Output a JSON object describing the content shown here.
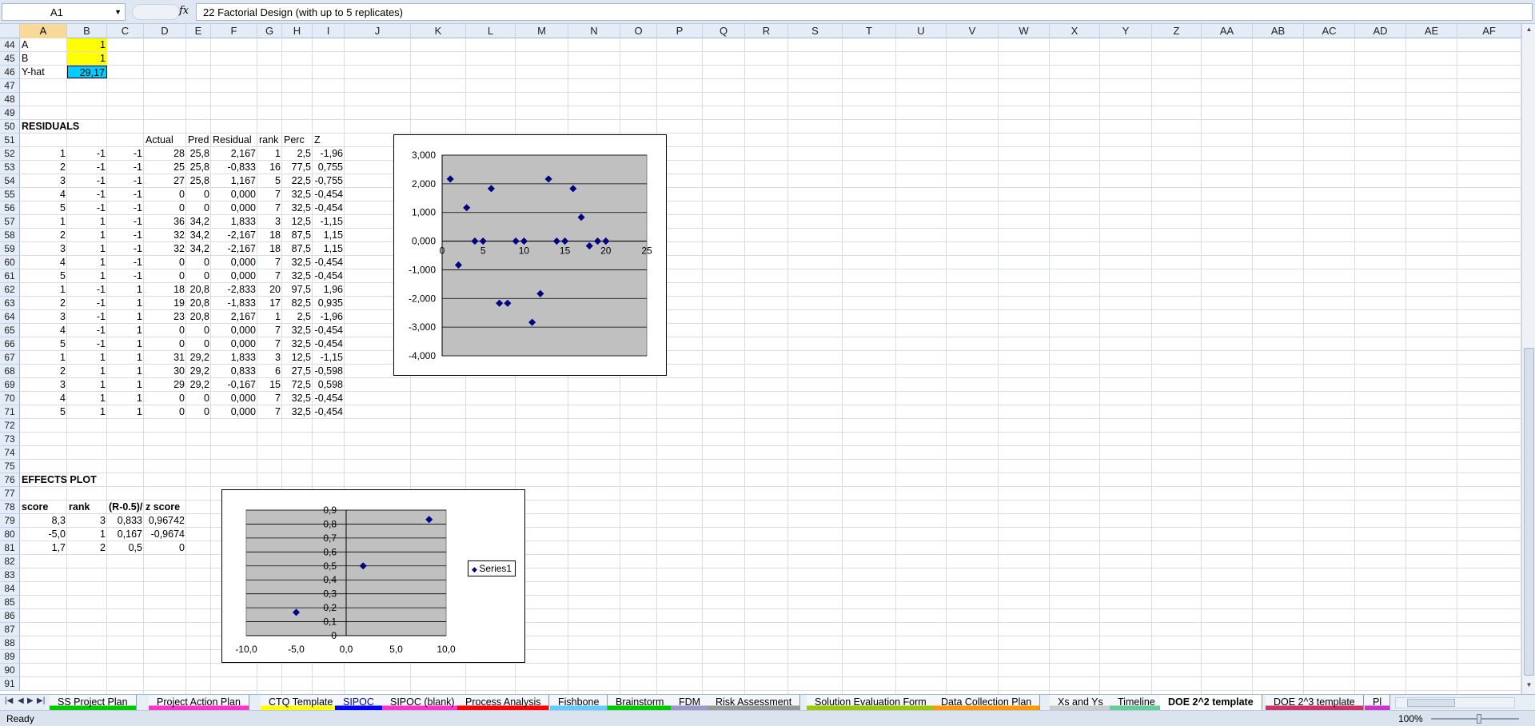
{
  "formula_bar": {
    "name_box": "A1",
    "fx": "fx",
    "formula": "22 Factorial Design (with up to 5 replicates)"
  },
  "columns": [
    "A",
    "B",
    "C",
    "D",
    "E",
    "F",
    "G",
    "H",
    "I",
    "J",
    "K",
    "L",
    "M",
    "N",
    "O",
    "P",
    "Q",
    "R",
    "S",
    "T",
    "U",
    "V",
    "W",
    "X",
    "Y",
    "Z",
    "AA",
    "AB",
    "AC",
    "AD",
    "AE",
    "AF"
  ],
  "rows": [
    "44",
    "45",
    "46",
    "47",
    "48",
    "49",
    "50",
    "51",
    "52",
    "53",
    "54",
    "55",
    "56",
    "57",
    "58",
    "59",
    "60",
    "61",
    "62",
    "63",
    "64",
    "65",
    "66",
    "67",
    "68",
    "69",
    "70",
    "71",
    "72",
    "73",
    "74",
    "75",
    "76",
    "77",
    "78",
    "79",
    "80",
    "81",
    "82",
    "83",
    "84",
    "85",
    "86",
    "87",
    "88",
    "89",
    "90",
    "91"
  ],
  "top_cells": {
    "a_label": "A",
    "a_val": "1",
    "b_label": "B",
    "b_val": "1",
    "yhat_label": "Y-hat",
    "yhat_val": "29,17"
  },
  "residuals": {
    "title": "RESIDUALS",
    "headers": [
      "Actual",
      "Pred",
      "Residual",
      "rank",
      "Perc",
      "Z"
    ],
    "rows": [
      [
        "1",
        "-1",
        "-1",
        "28",
        "25,8",
        "2,167",
        "1",
        "2,5",
        "-1,96"
      ],
      [
        "2",
        "-1",
        "-1",
        "25",
        "25,8",
        "-0,833",
        "16",
        "77,5",
        "0,755"
      ],
      [
        "3",
        "-1",
        "-1",
        "27",
        "25,8",
        "1,167",
        "5",
        "22,5",
        "-0,755"
      ],
      [
        "4",
        "-1",
        "-1",
        "0",
        "0",
        "0,000",
        "7",
        "32,5",
        "-0,454"
      ],
      [
        "5",
        "-1",
        "-1",
        "0",
        "0",
        "0,000",
        "7",
        "32,5",
        "-0,454"
      ],
      [
        "1",
        "1",
        "-1",
        "36",
        "34,2",
        "1,833",
        "3",
        "12,5",
        "-1,15"
      ],
      [
        "2",
        "1",
        "-1",
        "32",
        "34,2",
        "-2,167",
        "18",
        "87,5",
        "1,15"
      ],
      [
        "3",
        "1",
        "-1",
        "32",
        "34,2",
        "-2,167",
        "18",
        "87,5",
        "1,15"
      ],
      [
        "4",
        "1",
        "-1",
        "0",
        "0",
        "0,000",
        "7",
        "32,5",
        "-0,454"
      ],
      [
        "5",
        "1",
        "-1",
        "0",
        "0",
        "0,000",
        "7",
        "32,5",
        "-0,454"
      ],
      [
        "1",
        "-1",
        "1",
        "18",
        "20,8",
        "-2,833",
        "20",
        "97,5",
        "1,96"
      ],
      [
        "2",
        "-1",
        "1",
        "19",
        "20,8",
        "-1,833",
        "17",
        "82,5",
        "0,935"
      ],
      [
        "3",
        "-1",
        "1",
        "23",
        "20,8",
        "2,167",
        "1",
        "2,5",
        "-1,96"
      ],
      [
        "4",
        "-1",
        "1",
        "0",
        "0",
        "0,000",
        "7",
        "32,5",
        "-0,454"
      ],
      [
        "5",
        "-1",
        "1",
        "0",
        "0",
        "0,000",
        "7",
        "32,5",
        "-0,454"
      ],
      [
        "1",
        "1",
        "1",
        "31",
        "29,2",
        "1,833",
        "3",
        "12,5",
        "-1,15"
      ],
      [
        "2",
        "1",
        "1",
        "30",
        "29,2",
        "0,833",
        "6",
        "27,5",
        "-0,598"
      ],
      [
        "3",
        "1",
        "1",
        "29",
        "29,2",
        "-0,167",
        "15",
        "72,5",
        "0,598"
      ],
      [
        "4",
        "1",
        "1",
        "0",
        "0",
        "0,000",
        "7",
        "32,5",
        "-0,454"
      ],
      [
        "5",
        "1",
        "1",
        "0",
        "0",
        "0,000",
        "7",
        "32,5",
        "-0,454"
      ]
    ]
  },
  "effects": {
    "title": "EFFECTS PLOT",
    "headers": [
      "score",
      "rank",
      "(R-0.5)/",
      "z score"
    ],
    "rows": [
      [
        "8,3",
        "3",
        "0,833",
        "0,96742"
      ],
      [
        "-5,0",
        "1",
        "0,167",
        "-0,9674"
      ],
      [
        "1,7",
        "2",
        "0,5",
        "0"
      ]
    ]
  },
  "chart_data": [
    {
      "type": "scatter",
      "x": [
        1,
        2,
        3,
        4,
        5,
        6,
        7,
        8,
        9,
        10,
        11,
        12,
        13,
        14,
        15,
        16,
        17,
        18,
        19,
        20
      ],
      "y": [
        2.167,
        -0.833,
        1.167,
        0,
        0,
        1.833,
        -2.167,
        -2.167,
        0,
        0,
        -2.833,
        -1.833,
        2.167,
        0,
        0,
        1.833,
        0.833,
        -0.167,
        0,
        0
      ],
      "xlim": [
        0,
        25
      ],
      "ylim": [
        -4,
        3
      ],
      "x_ticks": [
        "0",
        "5",
        "10",
        "15",
        "20",
        "25"
      ],
      "y_ticks": [
        "3,000",
        "2,000",
        "1,000",
        "0,000",
        "-1,000",
        "-2,000",
        "-3,000",
        "-4,000"
      ],
      "grid": true,
      "marker_color": "#000080",
      "plot_bg": "#c0c0c0"
    },
    {
      "type": "scatter",
      "x": [
        8.3,
        -5.0,
        1.7
      ],
      "y": [
        0.833,
        0.167,
        0.5
      ],
      "xlim": [
        -10,
        10
      ],
      "ylim": [
        0,
        0.9
      ],
      "x_ticks": [
        "-10,0",
        "-5,0",
        "0,0",
        "5,0",
        "10,0"
      ],
      "y_ticks": [
        "0,9",
        "0,8",
        "0,7",
        "0,6",
        "0,5",
        "0,4",
        "0,3",
        "0,2",
        "0,1",
        "0"
      ],
      "series": [
        {
          "name": "Series1"
        }
      ],
      "legend": "right",
      "grid": true,
      "marker_color": "#000080",
      "plot_bg": "#c0c0c0"
    }
  ],
  "tabs": [
    "SS Project Plan",
    "Project Action Plan",
    "CTQ Template",
    "SIPOC",
    "SIPOC (blank)",
    "Process Analysis",
    "Fishbone",
    "Brainstorm",
    "FDM",
    "Risk Assessment",
    "Solution Evaluation Form",
    "Data Collection Plan",
    "Xs and Ys",
    "Timeline",
    "DOE 2^2 template",
    "DOE 2^3 template",
    "Pl"
  ],
  "tab_colors": [
    "#00cc00",
    "#ff33cc",
    "#ffff00",
    "#0000ff",
    "#ff33cc",
    "#ff0000",
    "#66ccff",
    "#00cc00",
    "#9999cc",
    "#999999",
    "#99cc00",
    "#ff9900",
    "#cccccc",
    "#66cc99",
    "#ffffff",
    "#cc3366",
    "#cc33cc"
  ],
  "active_tab": 14,
  "status": {
    "ready": "Ready",
    "zoom": "100%"
  }
}
